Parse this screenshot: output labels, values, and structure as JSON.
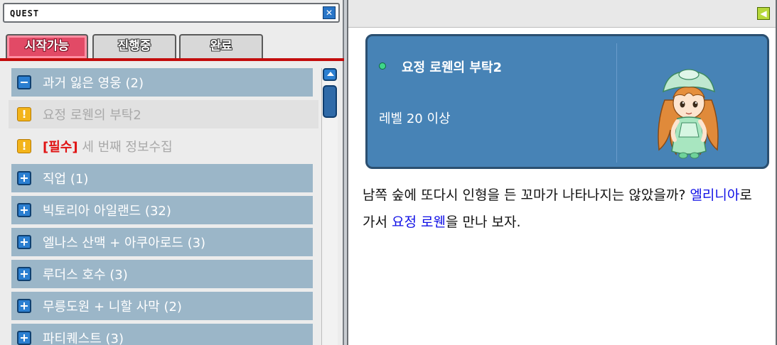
{
  "left_window": {
    "title": "QUEST",
    "tabs": [
      {
        "label": "시작가능",
        "active": true
      },
      {
        "label": "진행중",
        "active": false
      },
      {
        "label": "완료",
        "active": false
      }
    ],
    "list": [
      {
        "type": "category",
        "icon": "minus-icon",
        "label": "과거 잃은 영웅 (2)"
      },
      {
        "type": "item",
        "icon": "exclamation-icon",
        "label": "요정 로웬의 부탁2",
        "selected": true
      },
      {
        "type": "item",
        "icon": "exclamation-icon",
        "tag": "[필수]",
        "label": "세 번째 정보수집"
      },
      {
        "type": "category",
        "icon": "plus-icon",
        "label": "직업 (1)"
      },
      {
        "type": "category",
        "icon": "plus-icon",
        "label": "빅토리아 아일랜드 (32)"
      },
      {
        "type": "category",
        "icon": "plus-icon",
        "label": "엘나스 산맥 + 아쿠아로드 (3)"
      },
      {
        "type": "category",
        "icon": "plus-icon",
        "label": "루더스 호수 (3)"
      },
      {
        "type": "category",
        "icon": "plus-icon",
        "label": "무릉도원 + 니할 사막 (2)"
      },
      {
        "type": "category",
        "icon": "plus-icon",
        "label": "파티퀘스트 (3)"
      }
    ]
  },
  "right_window": {
    "quest_title": "요정 로웬의 부탁2",
    "level_requirement": "레벨 20 이상",
    "description": {
      "part1": "남쪽 숲에 또다시 인형을 든 꼬마가 나타나지는 않았을까? ",
      "place": "엘리니아",
      "part2": "로 가서 ",
      "npc": "요정 로웬",
      "part3": "을 만나 보자."
    }
  },
  "colors": {
    "active_tab": "#e24a66",
    "category_row": "#9bb6c8",
    "card_bg": "#4783b6",
    "highlight_text": "#1010e6",
    "required_tag": "#e01212"
  }
}
